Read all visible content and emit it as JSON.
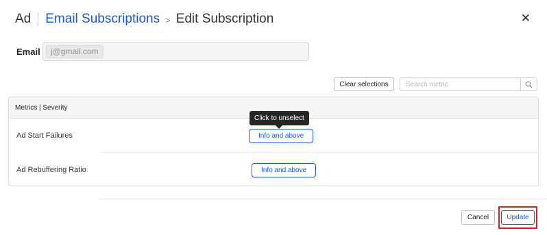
{
  "header": {
    "crumb": "Ad",
    "link": "Email Subscriptions",
    "separator": ">",
    "title": "Edit Subscription",
    "close_glyph": "✕"
  },
  "email": {
    "label": "Email",
    "value": "j@gmail.com"
  },
  "toolbar": {
    "clear_label": "Clear selections",
    "search_placeholder": "Search metric",
    "search_icon": "search-icon"
  },
  "table": {
    "header": "Metrics | Severity",
    "rows": [
      {
        "metric": "Ad Start Failures",
        "severity": "Info and above"
      },
      {
        "metric": "Ad Rebuffering Ratio",
        "severity": "Info and above"
      }
    ]
  },
  "tooltip": {
    "text": "Click to unselect"
  },
  "footer": {
    "cancel_label": "Cancel",
    "update_label": "Update",
    "highlight_color": "#d92020"
  },
  "colors": {
    "accent": "#1a56db"
  }
}
